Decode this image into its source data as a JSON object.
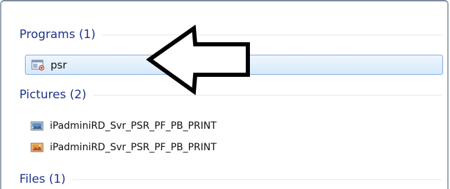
{
  "groups": {
    "programs": {
      "title": "Programs (1)",
      "items": [
        {
          "label": "psr",
          "icon": "program-icon",
          "selected": true
        }
      ]
    },
    "pictures": {
      "title": "Pictures (2)",
      "items": [
        {
          "label": "iPadminiRD_Svr_PSR_PF_PB_PRINT",
          "icon": "image-file-icon"
        },
        {
          "label": "iPadminiRD_Svr_PSR_PF_PB_PRINT",
          "icon": "photo-file-icon"
        }
      ]
    },
    "files": {
      "title": "Files (1)"
    }
  },
  "colors": {
    "header_text": "#1e3287",
    "selection_border": "#84acdd",
    "selection_fill": "#d7e9fa"
  },
  "annotation": {
    "icon": "left-arrow-icon"
  }
}
